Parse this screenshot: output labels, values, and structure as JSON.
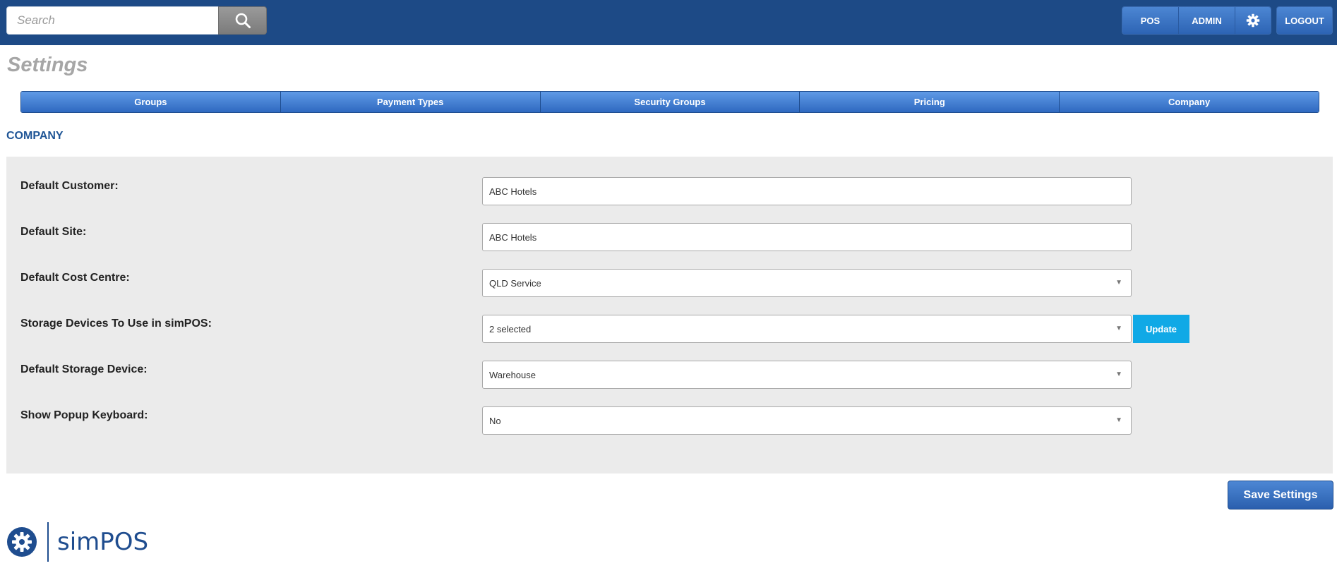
{
  "header": {
    "search_placeholder": "Search",
    "nav": {
      "pos": "POS",
      "admin": "ADMIN",
      "logout": "LOGOUT"
    }
  },
  "page": {
    "title": "Settings"
  },
  "tabs": [
    "Groups",
    "Payment Types",
    "Security Groups",
    "Pricing",
    "Company"
  ],
  "section": {
    "heading": "COMPANY"
  },
  "form": {
    "default_customer": {
      "label": "Default Customer:",
      "value": "ABC Hotels"
    },
    "default_site": {
      "label": "Default Site:",
      "value": "ABC Hotels"
    },
    "default_cost_centre": {
      "label": "Default Cost Centre:",
      "value": "QLD Service"
    },
    "storage_devices": {
      "label": "Storage Devices To Use in simPOS:",
      "value": "2 selected",
      "button": "Update"
    },
    "default_storage_device": {
      "label": "Default Storage Device:",
      "value": "Warehouse"
    },
    "popup_keyboard": {
      "label": "Show Popup Keyboard:",
      "value": "No"
    }
  },
  "actions": {
    "save": "Save Settings"
  },
  "footer": {
    "brand": "simPOS"
  },
  "colors": {
    "header_bg": "#1d4a86",
    "accent": "#2d64b4",
    "update_button": "#10a9e6",
    "panel_bg": "#ebebeb"
  },
  "icons": {
    "search": "search-icon",
    "settings": "gear-icon",
    "logo": "simpos-logo-icon",
    "dropdown": "chevron-down-icon"
  }
}
